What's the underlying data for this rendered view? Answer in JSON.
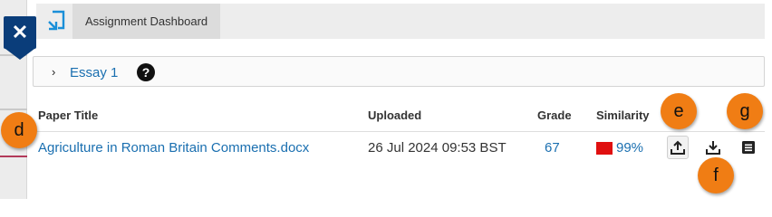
{
  "header": {
    "tab_label": "Assignment Dashboard"
  },
  "close": {
    "glyph": "✕"
  },
  "essay": {
    "title": "Essay 1",
    "chevron": "›",
    "help_glyph": "?"
  },
  "table": {
    "headers": {
      "paper_title": "Paper Title",
      "uploaded": "Uploaded",
      "grade": "Grade",
      "similarity": "Similarity"
    },
    "row": {
      "paper_title": "Agriculture in Roman Britain Comments.docx",
      "uploaded": "26 Jul 2024 09:53 BST",
      "grade": "67",
      "similarity": "99%",
      "similarity_color": "#e01010"
    }
  },
  "callouts": {
    "d": "d",
    "e": "e",
    "f": "f",
    "g": "g"
  },
  "colors": {
    "brand_navy": "#0a3d7a",
    "link_blue": "#1a6fb0",
    "callout_orange": "#f07d14"
  },
  "icons": [
    "close-icon",
    "app-logo-icon",
    "chevron-right-icon",
    "help-icon",
    "upload-icon",
    "download-icon",
    "menu-list-icon"
  ]
}
